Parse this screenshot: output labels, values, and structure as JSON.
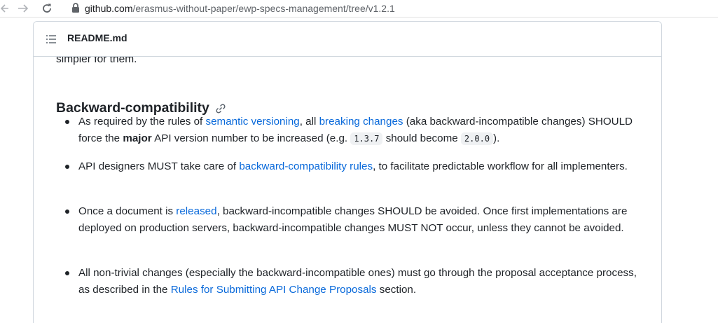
{
  "browser": {
    "url_host": "github.com",
    "url_path": "/erasmus-without-paper/ewp-specs-management/tree/v1.2.1"
  },
  "readme": {
    "title": "README.md",
    "scroll_fragment": "simpler for them."
  },
  "section": {
    "heading": "Backward-compatibility",
    "items": [
      {
        "t1": "As required by the rules of ",
        "l1": "semantic versioning",
        "t2": ", all ",
        "l2": "breaking changes",
        "t3": " (aka backward-incompatible changes) SHOULD force the ",
        "bold": "major",
        "t4": " API version number to be increased (e.g. ",
        "c1": "1.3.7",
        "t5": " should become ",
        "c2": "2.0.0",
        "t6": ")."
      },
      {
        "t1": "API designers MUST take care of ",
        "l1": "backward-compatibility rules",
        "t2": ", to facilitate predictable workflow for all implementers."
      },
      {
        "t1": "Once a document is ",
        "l1": "released",
        "t2": ", backward-incompatible changes SHOULD be avoided. Once first implementations are deployed on production servers, backward-incompatible changes MUST NOT occur, unless they cannot be avoided."
      },
      {
        "t1": "All non-trivial changes (especially the backward-incompatible ones) must go through the proposal acceptance process, as described in the ",
        "l1": "Rules for Submitting API Change Proposals",
        "t2": " section."
      }
    ]
  },
  "icons": {
    "back": "arrow-left-icon",
    "forward": "arrow-right-icon",
    "reload": "reload-icon",
    "lock": "lock-icon",
    "list": "list-unordered-icon",
    "anchor": "link-icon"
  },
  "colors": {
    "link": "#0969da",
    "text": "#1f2328",
    "border": "#d0d7de",
    "code_bg": "#eff1f3"
  }
}
